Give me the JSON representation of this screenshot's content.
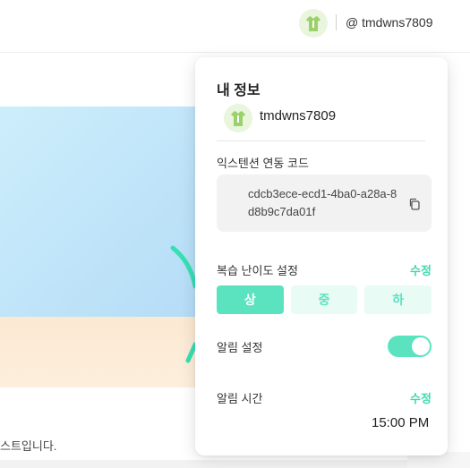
{
  "header": {
    "user_handle": "@ tmdwns7809",
    "avatar_icon": "user-avatar-icon"
  },
  "background": {
    "caption": "스트입니다."
  },
  "profile_panel": {
    "title": "내 정보",
    "username": "tmdwns7809",
    "extension_code_label": "익스텐션 연동 코드",
    "extension_code": "cdcb3ece-ecd1-4ba0-a28a-8d8b9c7da01f",
    "copy_icon": "copy-icon",
    "difficulty_label": "복습 난이도 설정",
    "difficulty_edit": "수정",
    "difficulty_options": [
      "상",
      "중",
      "하"
    ],
    "difficulty_selected": "상",
    "alarm_label": "알림 설정",
    "alarm_enabled": true,
    "alarm_time_label": "알림 시간",
    "alarm_time_edit": "수정",
    "alarm_time": "15:00 PM"
  },
  "colors": {
    "accent": "#5be3c0",
    "accent_light": "#e9fbf5",
    "link": "#3fd8b0"
  }
}
